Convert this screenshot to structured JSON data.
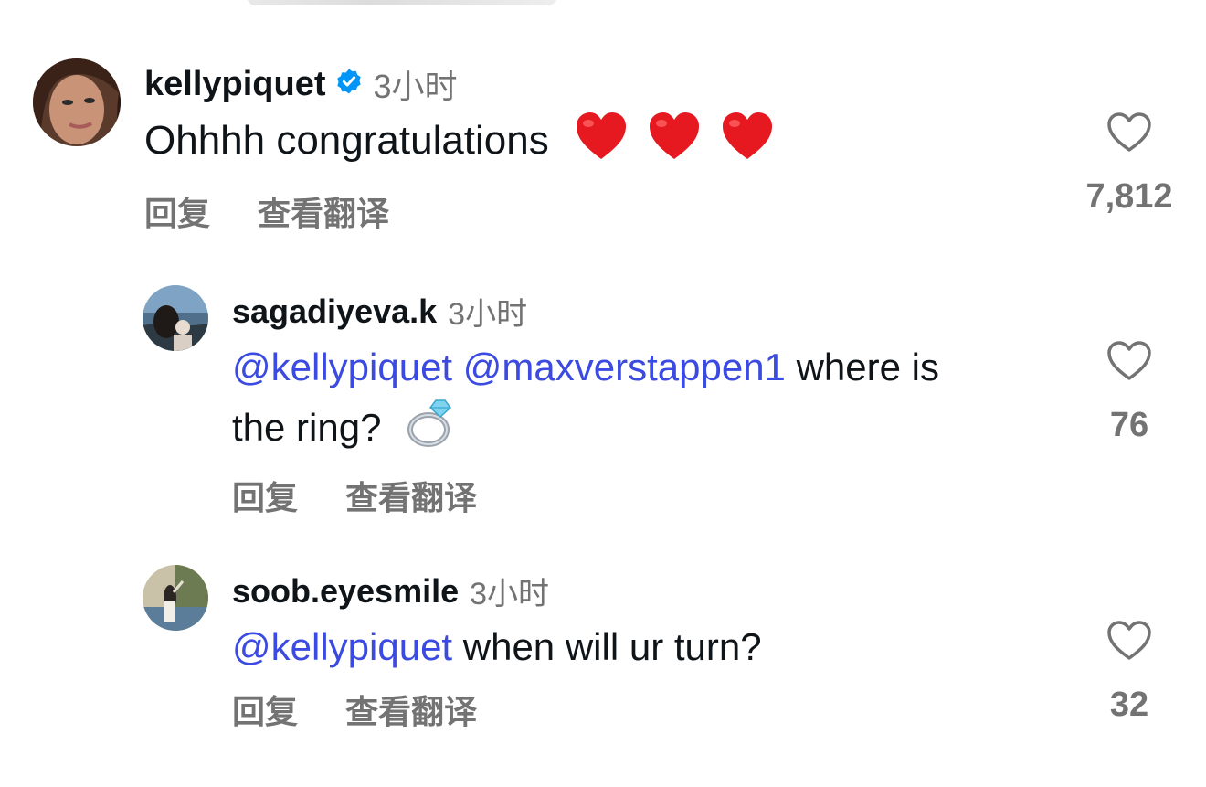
{
  "comments": [
    {
      "username": "kellypiquet",
      "verified": true,
      "time": "3小时",
      "text": "Ohhhh congratulations",
      "emoji": "red-heart x3",
      "reply_label": "回复",
      "translate_label": "查看翻译",
      "likes": "7,812"
    }
  ],
  "replies": [
    {
      "username": "sagadiyeva.k",
      "time": "3小时",
      "mentions": [
        "@kellypiquet",
        "@maxverstappen1"
      ],
      "text_line1": " where is",
      "text_line2": "the ring?",
      "emoji": "ring",
      "reply_label": "回复",
      "translate_label": "查看翻译",
      "likes": "76"
    },
    {
      "username": "soob.eyesmile",
      "time": "3小时",
      "mentions": [
        "@kellypiquet"
      ],
      "text": " when will ur turn?",
      "reply_label": "回复",
      "translate_label": "查看翻译",
      "likes": "32"
    }
  ],
  "colors": {
    "mention": "#3b4ae0",
    "verified": "#0095f6",
    "muted": "#737373",
    "text": "#0f1419"
  }
}
